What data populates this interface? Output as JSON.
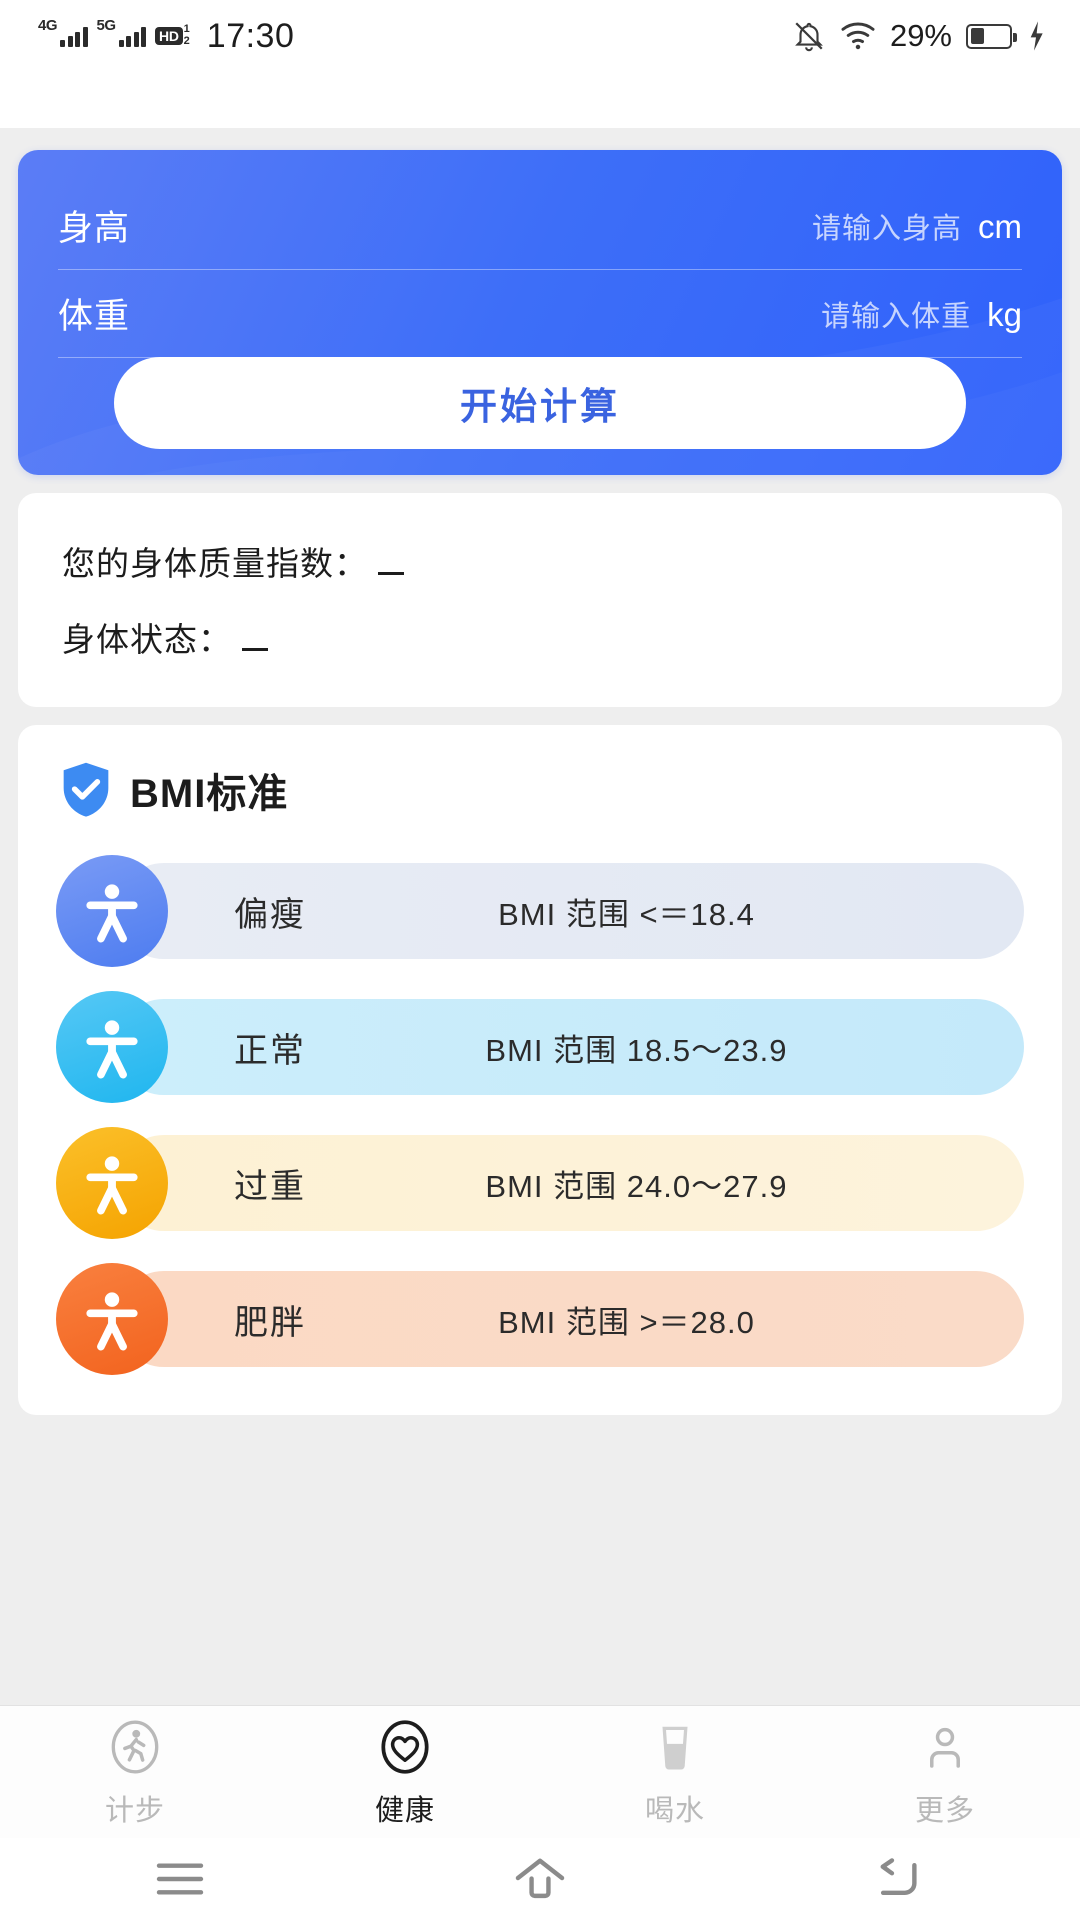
{
  "status_bar": {
    "network_4g": "4G",
    "network_5g": "5G",
    "hd_label": "HD",
    "hd_sup": "1",
    "hd_sub": "2",
    "time": "17:30",
    "battery_percent": "29%",
    "icons": [
      "mute-bell-icon",
      "wifi-icon",
      "battery-icon",
      "charging-bolt-icon"
    ]
  },
  "input_card": {
    "accent_color": "#3d6ef8",
    "height_row": {
      "label": "身高",
      "placeholder": "请输入身高",
      "value": "",
      "unit": "cm"
    },
    "weight_row": {
      "label": "体重",
      "placeholder": "请输入体重",
      "value": "",
      "unit": "kg"
    },
    "calculate_button": "开始计算",
    "calculate_button_color": "#3a63e0"
  },
  "result_card": {
    "bmi_label": "您的身体质量指数：",
    "bmi_value": "",
    "state_label": "身体状态：",
    "state_value": ""
  },
  "bmi_standard": {
    "title": "BMI标准",
    "shield_icon_color": "#3d8bf2",
    "rows": [
      {
        "name": "偏瘦",
        "range": "BMI 范围 <＝18.4",
        "avatar_color_start": "#7a9bf5",
        "avatar_color_end": "#4d7cf0",
        "pill_color_start": "#e8ecf4",
        "pill_color_end": "#e2e8f3"
      },
      {
        "name": "正常",
        "range": "BMI 范围 18.5～23.9",
        "avatar_color_start": "#56c8f5",
        "avatar_color_end": "#1fb6ef",
        "pill_color_start": "#cceefb",
        "pill_color_end": "#c4e9fa"
      },
      {
        "name": "过重",
        "range": "BMI 范围 24.0～27.9",
        "avatar_color_start": "#fbc02a",
        "avatar_color_end": "#f5a300",
        "pill_color_start": "#fdf1d4",
        "pill_color_end": "#fdf3dc"
      },
      {
        "name": "肥胖",
        "range": "BMI 范围 >＝28.0",
        "avatar_color_start": "#f9803f",
        "avatar_color_end": "#f2631e",
        "pill_color_start": "#fbd9c4",
        "pill_color_end": "#fadbc8"
      }
    ]
  },
  "tab_bar": {
    "tabs": [
      {
        "label": "计步",
        "icon": "walking-person-icon",
        "active": false
      },
      {
        "label": "健康",
        "icon": "heart-icon",
        "active": true
      },
      {
        "label": "喝水",
        "icon": "water-glass-icon",
        "active": false
      },
      {
        "label": "更多",
        "icon": "person-icon",
        "active": false
      }
    ]
  },
  "nav_bar": {
    "buttons": [
      {
        "icon": "recent-apps-icon"
      },
      {
        "icon": "home-icon"
      },
      {
        "icon": "back-icon"
      }
    ]
  }
}
